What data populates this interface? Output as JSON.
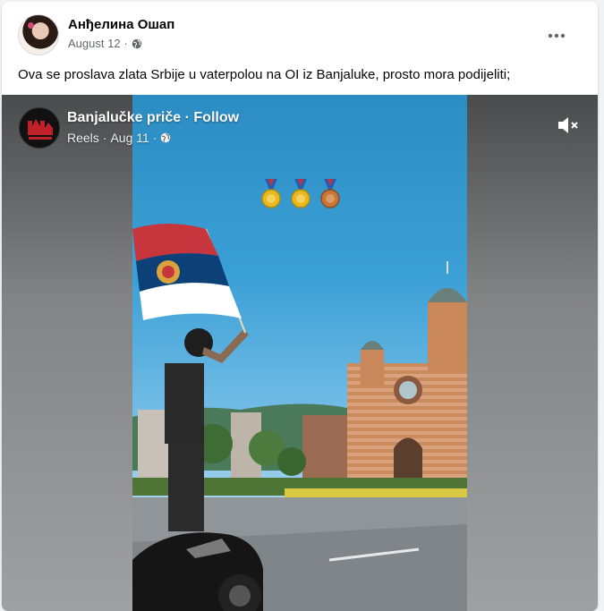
{
  "post": {
    "author": "Анђелина Ошап",
    "date": "August 12",
    "date_separator": "·",
    "privacy_icon": "globe-icon",
    "more_icon": "more-horizontal-icon",
    "text": "Ova se proslava zlata Srbije u vaterpolou na OI iz Banjaluke, prosto mora podijeliti;"
  },
  "reel": {
    "page_name": "Banjalučke priče",
    "separator": "·",
    "follow_label": "Follow",
    "type": "Reels",
    "date": "Aug 11",
    "date_separator": "·",
    "privacy_icon": "globe-icon",
    "mute_icon": "speaker-muted-icon",
    "medals": [
      "gold",
      "gold",
      "bronze"
    ]
  },
  "colors": {
    "sky_top": "#2c8cc4",
    "sky_bottom": "#a8d4ee",
    "gold": "#e8b923",
    "bronze": "#c8753a",
    "flag_red": "#c6363c",
    "flag_blue": "#0c4076",
    "flag_white": "#ffffff"
  }
}
